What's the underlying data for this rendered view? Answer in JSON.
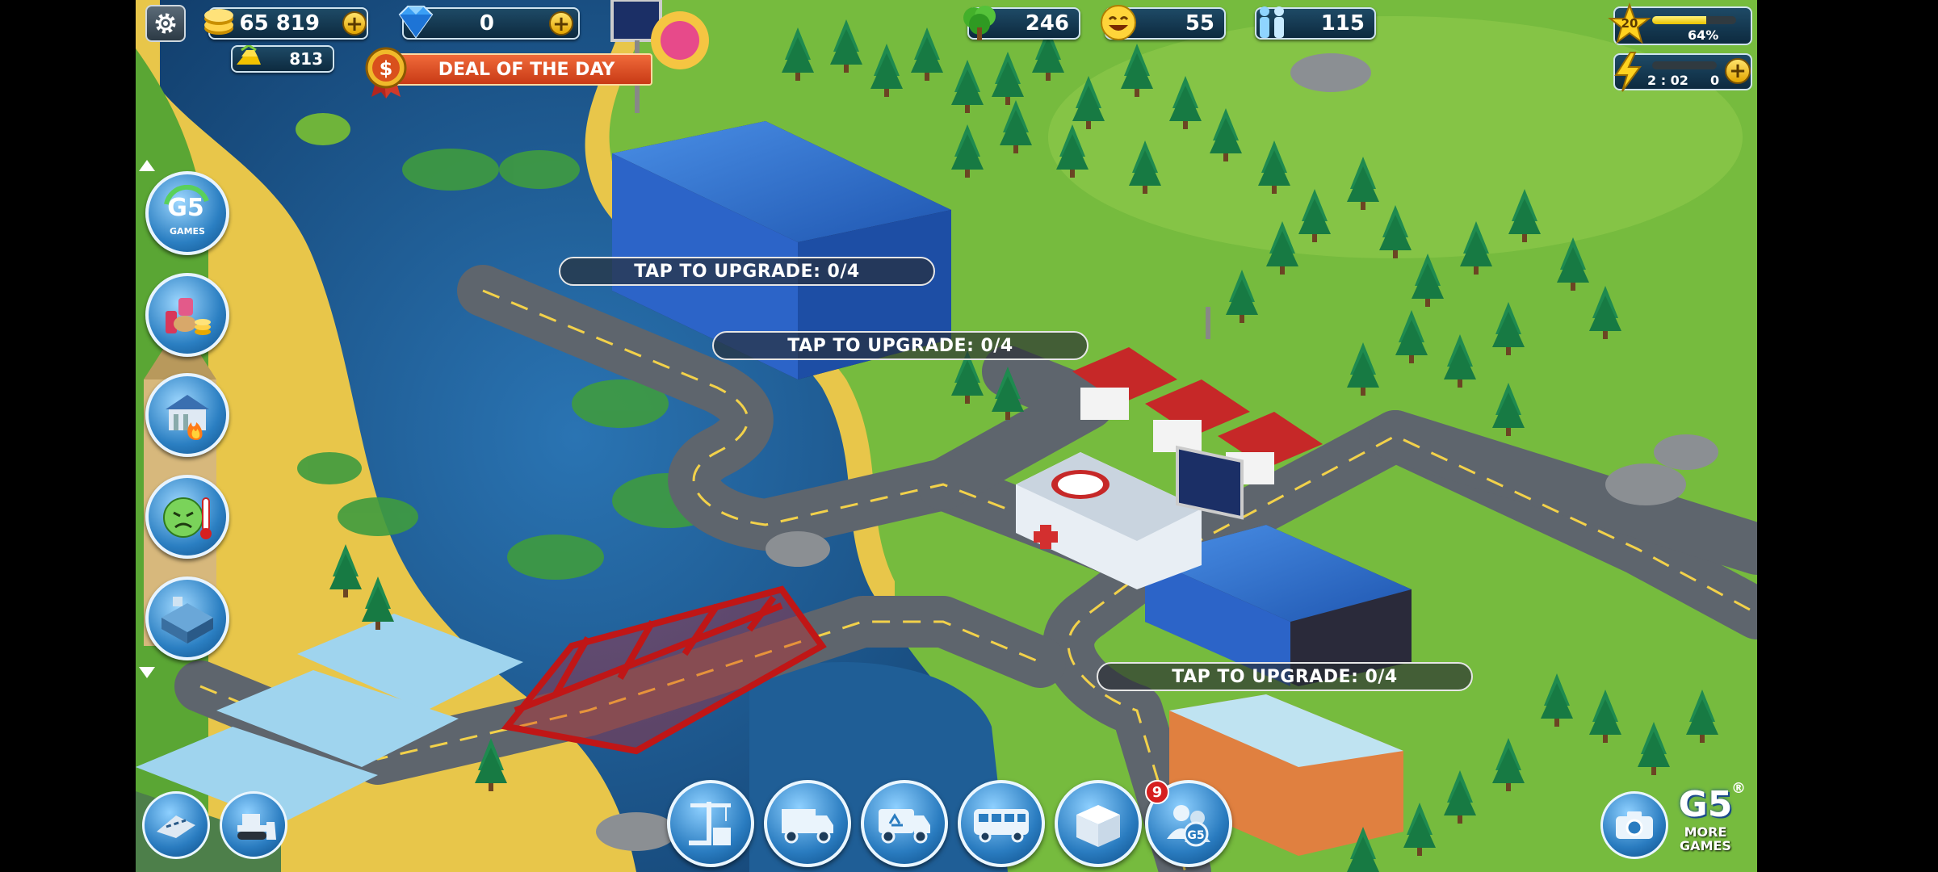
{
  "top_bar": {
    "coins": "65 819",
    "gold_bars": "813",
    "gems": "0",
    "deal_of_the_day": "DEAL OF THE DAY",
    "trees": "246",
    "happiness": "55",
    "population": "115"
  },
  "level_panel": {
    "level": "20",
    "xp_percent_label": "64%",
    "xp_fraction": 0.64,
    "energy_timer": "2 : 02",
    "energy_value": "0"
  },
  "upgrade_labels": [
    "TAP TO UPGRADE: 0/4",
    "TAP TO UPGRADE: 0/4",
    "TAP TO UPGRADE: 0/4"
  ],
  "side_menu": {
    "g5_logo_text": "GAMES"
  },
  "bottom_bar": {
    "notification_badge": "9",
    "more_games_logo": "G5",
    "more_games_label": "MORE\nGAMES",
    "registered_mark": "®"
  },
  "colors": {
    "grass": "#6fb43a",
    "water": "#1f5e96",
    "road": "#6b737c",
    "accent_blue": "#2b7fc2",
    "deal_red": "#d84a20"
  }
}
